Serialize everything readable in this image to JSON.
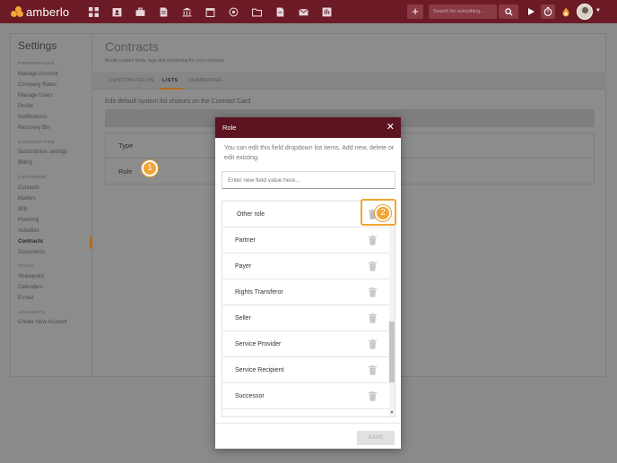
{
  "app": {
    "logo_text": "amberlo"
  },
  "topbar": {
    "plus_label": "+",
    "search_placeholder": "Search for everything...",
    "nav_icons": [
      "grid-icon",
      "calendar-user-icon",
      "briefcase-icon",
      "document-icon",
      "bank-icon",
      "calendar-icon",
      "whatsapp-icon",
      "folder-icon",
      "file-text-icon",
      "mail-icon",
      "invoice-icon"
    ],
    "accent_color": "#6b1a26"
  },
  "sidebar": {
    "title": "Settings",
    "sections": [
      {
        "heading": "PREFERENCES",
        "items": [
          "Manage Account",
          "Company Rates",
          "Manage Users",
          "Profile",
          "Notifications",
          "Recovery Bin"
        ]
      },
      {
        "heading": "SUBSCRIPTION",
        "items": [
          "Subscription settings",
          "Billing"
        ]
      },
      {
        "heading": "CUSTOMIZE",
        "items": [
          "Contacts",
          "Matters",
          "Bills",
          "Planning",
          "Activities",
          "Contracts",
          "Documents"
        ]
      },
      {
        "heading": "TOOLS",
        "items": [
          "Sharepoint",
          "Calendars",
          "E-mail"
        ]
      },
      {
        "heading": "ACCOUNTS",
        "items": [
          "Create New Account"
        ]
      }
    ],
    "active_item": "Contracts"
  },
  "content": {
    "title": "Contracts",
    "subtitle": "Modify custom fields, tags and numbering for your contracts.",
    "tabs": [
      "CUSTOM FIELDS",
      "LISTS",
      "NUMBERING"
    ],
    "active_tab": "LISTS",
    "edit_label": "Edit default system list choices on the Contract Card",
    "list_rows": [
      "Type",
      "Role"
    ]
  },
  "badges": {
    "one": "1",
    "two": "2",
    "color": "#f1a533"
  },
  "modal": {
    "title": "Role",
    "close": "✕",
    "description": "You can edit this field dropdown list items. Add new, delete or edit existing.",
    "input_placeholder": "Enter new field value here...",
    "items": [
      "Other role",
      "Partner",
      "Payer",
      "Rights Transferor",
      "Seller",
      "Service Provider",
      "Service Recipient",
      "Successor"
    ],
    "save_label": "SAVE",
    "header_color": "#5c1420"
  }
}
